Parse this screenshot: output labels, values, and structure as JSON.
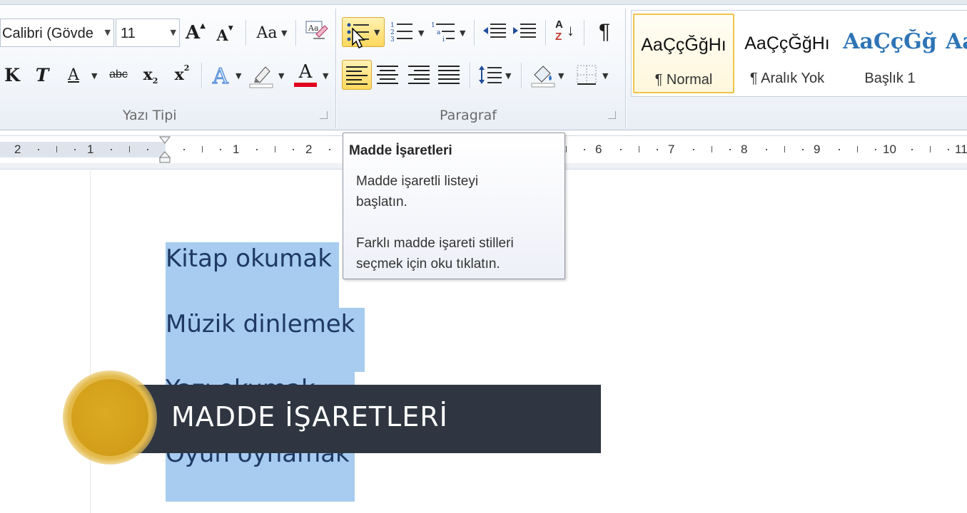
{
  "ribbon": {
    "font_combo": "Calibri (Gövde",
    "size_combo": "11",
    "grow_font": "A",
    "shrink_font": "A",
    "change_case": "Aa",
    "bold": "K",
    "italic": "T",
    "underline": "A",
    "strike": "abc",
    "subscript": "x",
    "subscript_small": "2",
    "superscript": "x",
    "superscript_small": "2",
    "font_color": "A",
    "groups": {
      "font_label": "Yazı Tipi",
      "paragraph_label": "Paragraf"
    },
    "pilcrow": "¶",
    "sort_label_a": "A",
    "sort_label_z": "Z",
    "styles": [
      {
        "sample": "AaÇçĞğHı",
        "name": "¶ Normal"
      },
      {
        "sample": "AaÇçĞğHı",
        "name": "¶ Aralık Yok"
      },
      {
        "sample": "AaÇçĞğ",
        "name": "Başlık 1"
      },
      {
        "sample": "Aa",
        "name": ""
      }
    ]
  },
  "ruler": {
    "numbers_left": [
      "2",
      "1"
    ],
    "numbers_right": [
      "1",
      "2",
      "6",
      "7",
      "8",
      "9",
      "10",
      "11"
    ]
  },
  "tooltip": {
    "title": "Madde İşaretleri",
    "line1": "Madde işaretli listeyi",
    "line2": "başlatın.",
    "line3": "Farklı madde işareti stilleri",
    "line4": "seçmek için oku tıklatın."
  },
  "document": {
    "lines": [
      "Kitap okumak",
      "Müzik dinlemek",
      "Yazı okumak",
      "Oyun oynamak"
    ]
  },
  "overlay": {
    "banner_text": "MADDE İŞARETLERİ"
  },
  "colors": {
    "selection": "#a7ccef",
    "doc_text": "#1f3864",
    "banner_bg": "#2f3641",
    "accent_gold": "#d6a21f",
    "font_color_bar": "#e0001b",
    "highlight_bar": "#ffffff",
    "heading_blue": "#2e74b5"
  },
  "icons": [
    "grow-font-icon",
    "shrink-font-icon",
    "clear-formatting-icon",
    "bullets-icon",
    "numbering-icon",
    "multilevel-list-icon",
    "decrease-indent-icon",
    "increase-indent-icon",
    "sort-icon",
    "show-marks-icon",
    "text-effects-icon",
    "highlight-icon",
    "font-color-icon",
    "align-left-icon",
    "align-center-icon",
    "align-right-icon",
    "justify-icon",
    "line-spacing-icon",
    "shading-icon",
    "borders-icon",
    "mouse-pointer-icon"
  ]
}
